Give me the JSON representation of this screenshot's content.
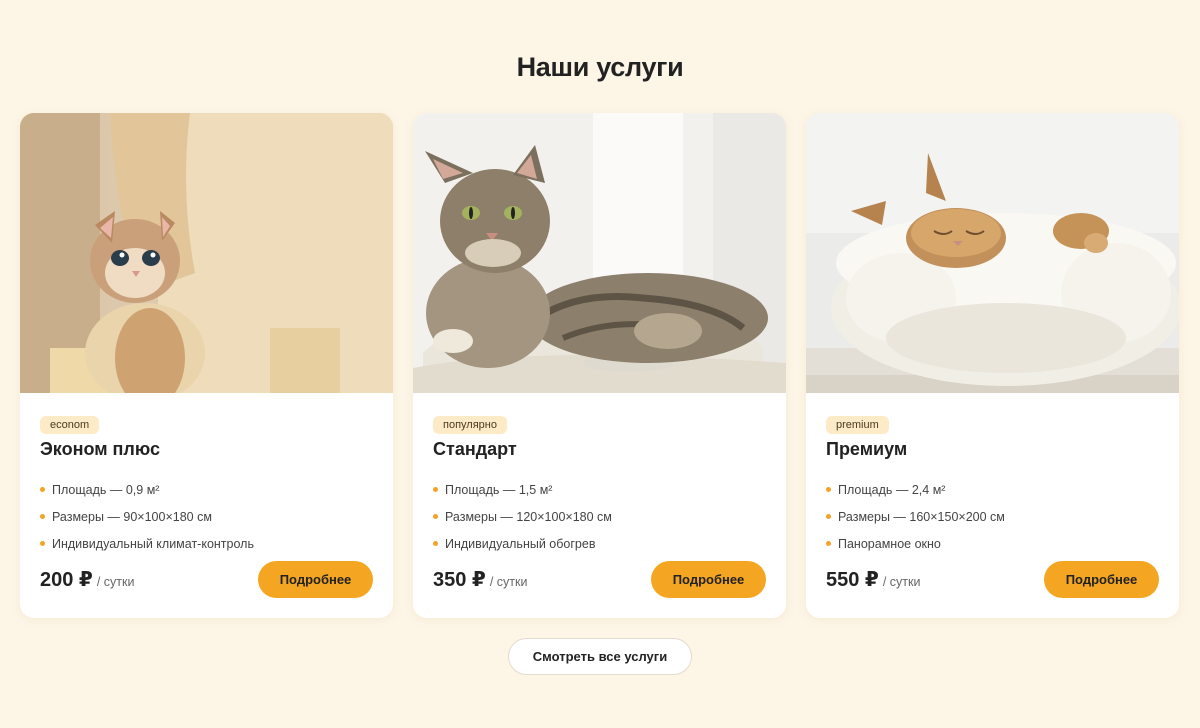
{
  "section": {
    "title": "Наши услуги"
  },
  "cards": [
    {
      "photo": "kitten-in-cat-tree",
      "badge": "econom",
      "title": "Эконом плюс",
      "features": [
        "Площадь — 0,9 м²",
        "Размеры — 90×100×180 см",
        "Индивидуальный климат-контроль"
      ],
      "price": "200 ₽",
      "price_unit": "/ сутки",
      "button": "Подробнее"
    },
    {
      "photo": "tabby-cat-on-cushion",
      "badge": "популярно",
      "title": "Стандарт",
      "features": [
        "Площадь — 1,5 м²",
        "Размеры — 120×100×180 см",
        "Индивидуальный обогрев"
      ],
      "price": "350 ₽",
      "price_unit": "/ сутки",
      "button": "Подробнее"
    },
    {
      "photo": "cat-sleeping-in-fluffy-bed",
      "badge": "premium",
      "title": "Премиум",
      "features": [
        "Площадь — 2,4 м²",
        "Размеры — 160×150×200 см",
        "Панорамное окно"
      ],
      "price": "550 ₽",
      "price_unit": "/ сутки",
      "button": "Подробнее"
    }
  ],
  "all_services_button": "Смотреть все услуги",
  "colors": {
    "background": "#fdf5e6",
    "accent": "#f4a623",
    "badge": "#fcebc6",
    "bullet": "#f3a325"
  }
}
